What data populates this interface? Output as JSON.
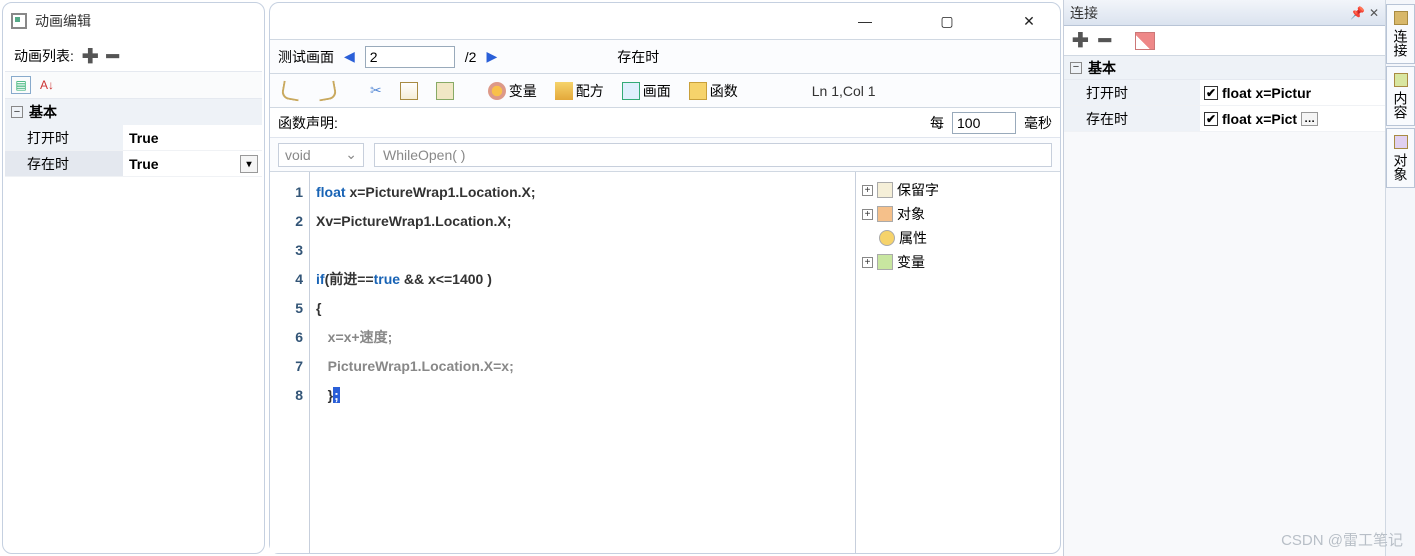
{
  "left": {
    "title": "动画编辑",
    "listLabel": "动画列表:",
    "category": "基本",
    "rows": [
      {
        "name": "打开时",
        "value": "True"
      },
      {
        "name": "存在时",
        "value": "True"
      }
    ]
  },
  "mid": {
    "nav": {
      "label": "测试画面",
      "page": "2",
      "total": "/2",
      "eventLabel": "存在时"
    },
    "toolbar": {
      "varBtn": "变量",
      "recipeBtn": "配方",
      "screenBtn": "画面",
      "funcBtn": "函数",
      "cursor": "Ln 1,Col 1"
    },
    "funcDecl": {
      "label": "函数声明:",
      "everyLabel": "每",
      "ms": "100",
      "msUnit": "毫秒"
    },
    "ret": {
      "type": "void",
      "fn": "WhileOpen( )"
    },
    "code": {
      "lines": [
        "1",
        "2",
        "3",
        "4",
        "5",
        "6",
        "7",
        "8"
      ],
      "l1_kw": "float",
      "l1_rest": " x=PictureWrap1.Location.X;",
      "l2": "Xv=PictureWrap1.Location.X;",
      "l3": "",
      "l4_a": "if",
      "l4_b": "(前进==",
      "l4_c": "true",
      "l4_d": " && x<=1400 )",
      "l5": "{",
      "l6": "   x=x+速度;",
      "l7": "   PictureWrap1.Location.X=x;",
      "l8a": "   }",
      "l8b": ";"
    },
    "tree": {
      "t1": "保留字",
      "t2": "对象",
      "t3": "属性",
      "t4": "变量"
    }
  },
  "right": {
    "title": "连接",
    "category": "基本",
    "rows": [
      {
        "name": "打开时",
        "value": "float x=Pictur"
      },
      {
        "name": "存在时",
        "value": "float x=Pict"
      }
    ]
  },
  "sideTabs": {
    "t1": "连接",
    "t2": "内容",
    "t3": "对象"
  },
  "watermark": "CSDN @雷工笔记"
}
